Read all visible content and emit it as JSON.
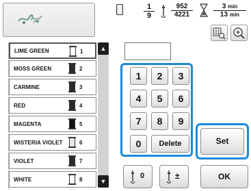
{
  "stitch_info": {
    "color_current": "1",
    "color_total": "9",
    "stitch_current": "952",
    "stitch_total": "4221",
    "time_current": "3",
    "time_total": "13",
    "time_unit": "min"
  },
  "threads": [
    {
      "name": "LIME GREEN",
      "num": "1",
      "color": "#ffffff"
    },
    {
      "name": "MOSS GREEN",
      "num": "2",
      "color": "#2a2a2a"
    },
    {
      "name": "CARMINE",
      "num": "3",
      "color": "#2a2a2a"
    },
    {
      "name": "RED",
      "num": "4",
      "color": "#2a2a2a"
    },
    {
      "name": "MAGENTA",
      "num": "5",
      "color": "#111111"
    },
    {
      "name": "WISTERIA VIOLET",
      "num": "6",
      "color": "#e6e6e6"
    },
    {
      "name": "VIOLET",
      "num": "7",
      "color": "#2a2a2a"
    },
    {
      "name": "WHITE",
      "num": "8",
      "color": "#ffffff"
    }
  ],
  "keypad": {
    "k1": "1",
    "k2": "2",
    "k3": "3",
    "k4": "4",
    "k5": "5",
    "k6": "6",
    "k7": "7",
    "k8": "8",
    "k9": "9",
    "k0": "0",
    "delete": "Delete"
  },
  "buttons": {
    "set": "Set",
    "ok": "OK",
    "needle_count": "0",
    "needle_pm": "±"
  },
  "scroll": {
    "up": "▲",
    "down": "▼"
  },
  "colors": {
    "highlight": "#1e88d8",
    "scroll_track": "#d2d2d2"
  },
  "icons": [
    "embroidery-pattern-thumbnail",
    "spool-icon",
    "needle-icon",
    "hourglass-icon",
    "grid-zoom-icon",
    "magnifier-icon"
  ]
}
